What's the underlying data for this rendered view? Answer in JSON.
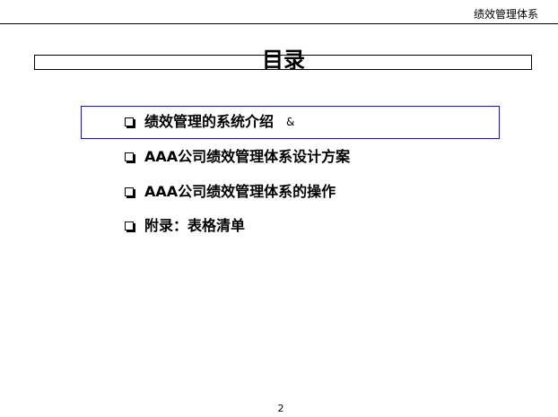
{
  "header": {
    "section_title": "绩效管理体系"
  },
  "title": "目录",
  "toc": {
    "items": [
      {
        "label": "绩效管理的系统介绍",
        "mark": "&"
      },
      {
        "label": "AAA公司绩效管理体系设计方案"
      },
      {
        "label": "AAA公司绩效管理体系的操作"
      },
      {
        "label": "附录：表格清单"
      }
    ]
  },
  "footer": {
    "page_number": "2"
  },
  "colors": {
    "highlight_border": "#1a1aa0",
    "text": "#000000",
    "background": "#ffffff"
  }
}
